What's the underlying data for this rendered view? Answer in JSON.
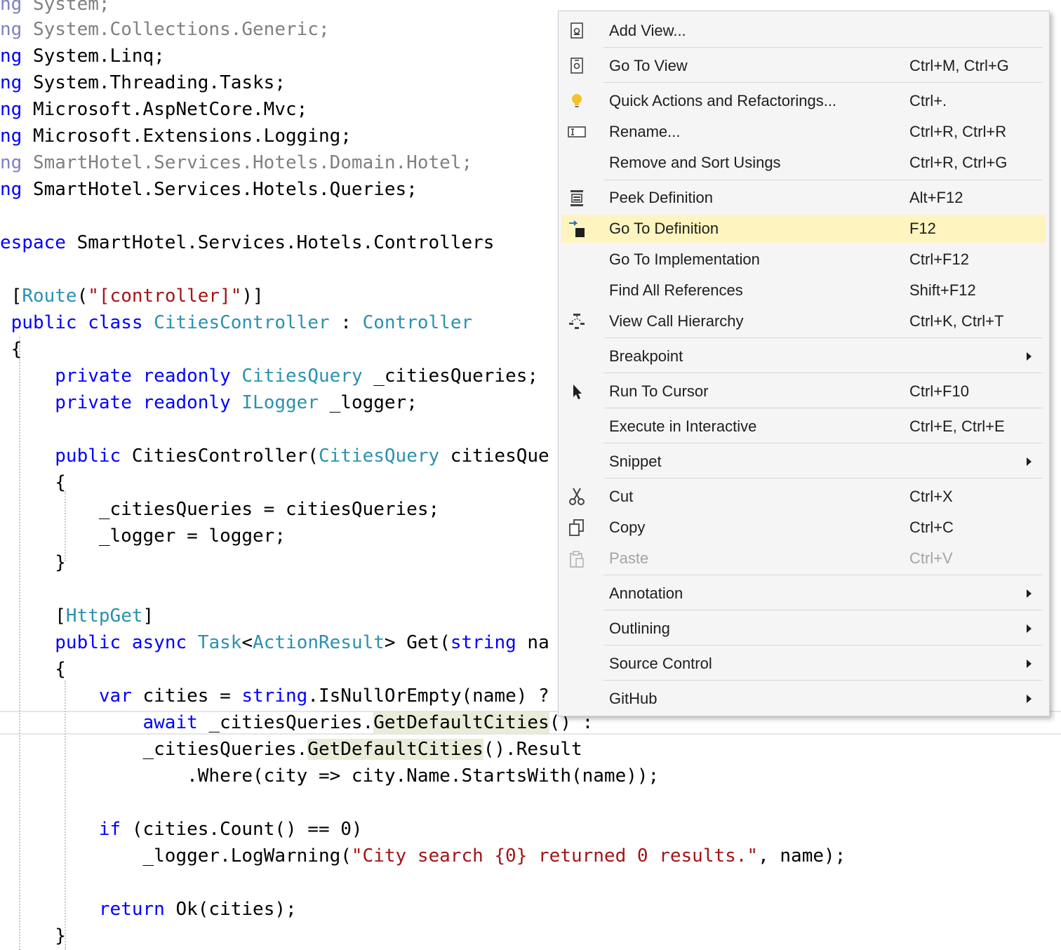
{
  "editor": {
    "lines": [
      {
        "parts": [
          {
            "t": "ng",
            "c": "us"
          },
          {
            "t": " System;",
            "c": "gr"
          }
        ]
      },
      {
        "parts": [
          {
            "t": "ng",
            "c": "us"
          },
          {
            "t": " System.Collections.Generic;",
            "c": "gr"
          }
        ]
      },
      {
        "parts": [
          {
            "t": "ng",
            "c": "kw"
          },
          {
            "t": " System.Linq;",
            "c": ""
          }
        ]
      },
      {
        "parts": [
          {
            "t": "ng",
            "c": "kw"
          },
          {
            "t": " System.Threading.Tasks;",
            "c": ""
          }
        ]
      },
      {
        "parts": [
          {
            "t": "ng",
            "c": "kw"
          },
          {
            "t": " Microsoft.AspNetCore.Mvc;",
            "c": ""
          }
        ]
      },
      {
        "parts": [
          {
            "t": "ng",
            "c": "kw"
          },
          {
            "t": " Microsoft.Extensions.Logging;",
            "c": ""
          }
        ]
      },
      {
        "parts": [
          {
            "t": "ng",
            "c": "us"
          },
          {
            "t": " SmartHotel.Services.Hotels.Domain.Hotel;",
            "c": "gr"
          }
        ]
      },
      {
        "parts": [
          {
            "t": "ng",
            "c": "kw"
          },
          {
            "t": " SmartHotel.Services.Hotels.Queries;",
            "c": ""
          }
        ]
      },
      {
        "parts": []
      },
      {
        "parts": [
          {
            "t": "espace",
            "c": "kw"
          },
          {
            "t": " SmartHotel.Services.Hotels.Controllers",
            "c": ""
          }
        ]
      },
      {
        "parts": []
      },
      {
        "parts": [
          {
            "t": " [",
            "c": ""
          },
          {
            "t": "Route",
            "c": "ty"
          },
          {
            "t": "(",
            "c": ""
          },
          {
            "t": "\"[controller]\"",
            "c": "st"
          },
          {
            "t": ")]",
            "c": ""
          }
        ]
      },
      {
        "parts": [
          {
            "t": " ",
            "c": ""
          },
          {
            "t": "public",
            "c": "kw"
          },
          {
            "t": " ",
            "c": ""
          },
          {
            "t": "class",
            "c": "kw"
          },
          {
            "t": " ",
            "c": ""
          },
          {
            "t": "CitiesController",
            "c": "ty"
          },
          {
            "t": " : ",
            "c": ""
          },
          {
            "t": "Controller",
            "c": "ty"
          }
        ]
      },
      {
        "parts": [
          {
            "t": " {",
            "c": ""
          }
        ]
      },
      {
        "parts": [
          {
            "t": "     ",
            "c": ""
          },
          {
            "t": "private",
            "c": "kw"
          },
          {
            "t": " ",
            "c": ""
          },
          {
            "t": "readonly",
            "c": "kw"
          },
          {
            "t": " ",
            "c": ""
          },
          {
            "t": "CitiesQuery",
            "c": "ty"
          },
          {
            "t": " _citiesQueries;",
            "c": ""
          }
        ]
      },
      {
        "parts": [
          {
            "t": "     ",
            "c": ""
          },
          {
            "t": "private",
            "c": "kw"
          },
          {
            "t": " ",
            "c": ""
          },
          {
            "t": "readonly",
            "c": "kw"
          },
          {
            "t": " ",
            "c": ""
          },
          {
            "t": "ILogger",
            "c": "ty"
          },
          {
            "t": " _logger;",
            "c": ""
          }
        ]
      },
      {
        "parts": []
      },
      {
        "parts": [
          {
            "t": "     ",
            "c": ""
          },
          {
            "t": "public",
            "c": "kw"
          },
          {
            "t": " CitiesController(",
            "c": ""
          },
          {
            "t": "CitiesQuery",
            "c": "ty"
          },
          {
            "t": " citiesQue",
            "c": ""
          }
        ]
      },
      {
        "parts": [
          {
            "t": "     {",
            "c": ""
          }
        ]
      },
      {
        "parts": [
          {
            "t": "         _citiesQueries = citiesQueries;",
            "c": ""
          }
        ]
      },
      {
        "parts": [
          {
            "t": "         _logger = logger;",
            "c": ""
          }
        ]
      },
      {
        "parts": [
          {
            "t": "     }",
            "c": ""
          }
        ]
      },
      {
        "parts": []
      },
      {
        "parts": [
          {
            "t": "     [",
            "c": ""
          },
          {
            "t": "HttpGet",
            "c": "ty"
          },
          {
            "t": "]",
            "c": ""
          }
        ]
      },
      {
        "parts": [
          {
            "t": "     ",
            "c": ""
          },
          {
            "t": "public",
            "c": "kw"
          },
          {
            "t": " ",
            "c": ""
          },
          {
            "t": "async",
            "c": "kw"
          },
          {
            "t": " ",
            "c": ""
          },
          {
            "t": "Task",
            "c": "ty"
          },
          {
            "t": "<",
            "c": ""
          },
          {
            "t": "ActionResult",
            "c": "ty"
          },
          {
            "t": "> Get(",
            "c": ""
          },
          {
            "t": "string",
            "c": "kw"
          },
          {
            "t": " na",
            "c": ""
          }
        ]
      },
      {
        "parts": [
          {
            "t": "     {",
            "c": ""
          }
        ]
      },
      {
        "parts": [
          {
            "t": "         ",
            "c": ""
          },
          {
            "t": "var",
            "c": "kw"
          },
          {
            "t": " cities = ",
            "c": ""
          },
          {
            "t": "string",
            "c": "kw"
          },
          {
            "t": ".IsNullOrEmpty(name) ?",
            "c": ""
          }
        ]
      },
      {
        "parts": [
          {
            "t": "             ",
            "c": ""
          },
          {
            "t": "await",
            "c": "kw"
          },
          {
            "t": " _citiesQueries.",
            "c": ""
          },
          {
            "t": "GetDefaultCities",
            "c": "hl"
          },
          {
            "t": "() :",
            "c": ""
          }
        ]
      },
      {
        "parts": [
          {
            "t": "             _citiesQueries.",
            "c": ""
          },
          {
            "t": "GetDefaultCities",
            "c": "hl"
          },
          {
            "t": "().Result",
            "c": ""
          }
        ]
      },
      {
        "parts": [
          {
            "t": "                 .Where(city => city.Name.StartsWith(name));",
            "c": ""
          }
        ]
      },
      {
        "parts": []
      },
      {
        "parts": [
          {
            "t": "         ",
            "c": ""
          },
          {
            "t": "if",
            "c": "kw"
          },
          {
            "t": " (cities.Count() == 0)",
            "c": ""
          }
        ]
      },
      {
        "parts": [
          {
            "t": "             _logger.LogWarning(",
            "c": ""
          },
          {
            "t": "\"City search {0} returned 0 results.\"",
            "c": "st"
          },
          {
            "t": ", name);",
            "c": ""
          }
        ]
      },
      {
        "parts": []
      },
      {
        "parts": [
          {
            "t": "         ",
            "c": ""
          },
          {
            "t": "return",
            "c": "kw"
          },
          {
            "t": " Ok(cities);",
            "c": ""
          }
        ]
      },
      {
        "parts": [
          {
            "t": "     }",
            "c": ""
          }
        ]
      }
    ]
  },
  "context_menu": {
    "items": [
      {
        "label": "Add View...",
        "shortcut": "",
        "icon": "add-view-icon"
      },
      {
        "label": "Go To View",
        "shortcut": "Ctrl+M, Ctrl+G",
        "icon": "go-to-view-icon"
      },
      {
        "label": "Quick Actions and Refactorings...",
        "shortcut": "Ctrl+.",
        "icon": "lightbulb-icon"
      },
      {
        "label": "Rename...",
        "shortcut": "Ctrl+R, Ctrl+R",
        "icon": "rename-icon"
      },
      {
        "label": "Remove and Sort Usings",
        "shortcut": "Ctrl+R, Ctrl+G",
        "icon": ""
      },
      {
        "label": "Peek Definition",
        "shortcut": "Alt+F12",
        "icon": "peek-definition-icon"
      },
      {
        "label": "Go To Definition",
        "shortcut": "F12",
        "icon": "go-to-definition-icon",
        "active": true
      },
      {
        "label": "Go To Implementation",
        "shortcut": "Ctrl+F12",
        "icon": ""
      },
      {
        "label": "Find All References",
        "shortcut": "Shift+F12",
        "icon": ""
      },
      {
        "label": "View Call Hierarchy",
        "shortcut": "Ctrl+K, Ctrl+T",
        "icon": "call-hierarchy-icon"
      },
      {
        "label": "Breakpoint",
        "shortcut": "",
        "icon": "",
        "submenu": true
      },
      {
        "label": "Run To Cursor",
        "shortcut": "Ctrl+F10",
        "icon": "cursor-icon"
      },
      {
        "label": "Execute in Interactive",
        "shortcut": "Ctrl+E, Ctrl+E",
        "icon": ""
      },
      {
        "label": "Snippet",
        "shortcut": "",
        "icon": "",
        "submenu": true
      },
      {
        "label": "Cut",
        "shortcut": "Ctrl+X",
        "icon": "scissors-icon"
      },
      {
        "label": "Copy",
        "shortcut": "Ctrl+C",
        "icon": "copy-icon"
      },
      {
        "label": "Paste",
        "shortcut": "Ctrl+V",
        "icon": "paste-icon",
        "disabled": true
      },
      {
        "label": "Annotation",
        "shortcut": "",
        "icon": "",
        "submenu": true
      },
      {
        "label": "Outlining",
        "shortcut": "",
        "icon": "",
        "submenu": true
      },
      {
        "label": "Source Control",
        "shortcut": "",
        "icon": "",
        "submenu": true
      },
      {
        "label": "GitHub",
        "shortcut": "",
        "icon": "",
        "submenu": true
      }
    ]
  },
  "colors": {
    "keyword": "#0000ff",
    "type": "#2b91af",
    "string": "#a31515",
    "menu_highlight": "#fdf4bf"
  }
}
